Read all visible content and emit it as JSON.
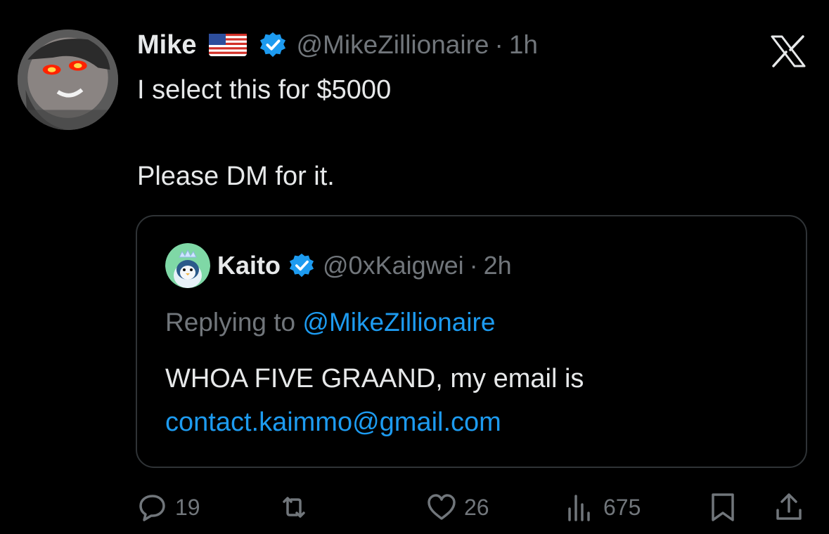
{
  "tweet": {
    "author_name": "Mike",
    "author_flag": "🇺🇸",
    "author_handle": "@MikeZillionaire",
    "separator": "·",
    "time": "1h",
    "text_line1": "I select this for $5000",
    "text_line2": "Please DM for it."
  },
  "quote": {
    "author_name": "Kaito",
    "author_handle": "@0xKaigwei",
    "separator": "·",
    "time": "2h",
    "replying_prefix": "Replying to ",
    "replying_handle": "@MikeZillionaire",
    "body_line1": "WHOA FIVE GRAAND, my email is",
    "body_line2": "contact.kaimmo@gmail.com"
  },
  "actions": {
    "replies": "19",
    "likes": "26",
    "views": "675"
  },
  "icons": {
    "logo": "x-logo-icon",
    "verified": "verified-badge-icon",
    "reply": "reply-icon",
    "retweet": "retweet-icon",
    "like": "heart-icon",
    "views": "views-icon",
    "bookmark": "bookmark-icon",
    "share": "share-icon"
  },
  "colors": {
    "background": "#000000",
    "text": "#e7e9ea",
    "muted": "#71767b",
    "link": "#1d9bf0",
    "verified": "#1d9bf0",
    "border": "#2f3336"
  }
}
